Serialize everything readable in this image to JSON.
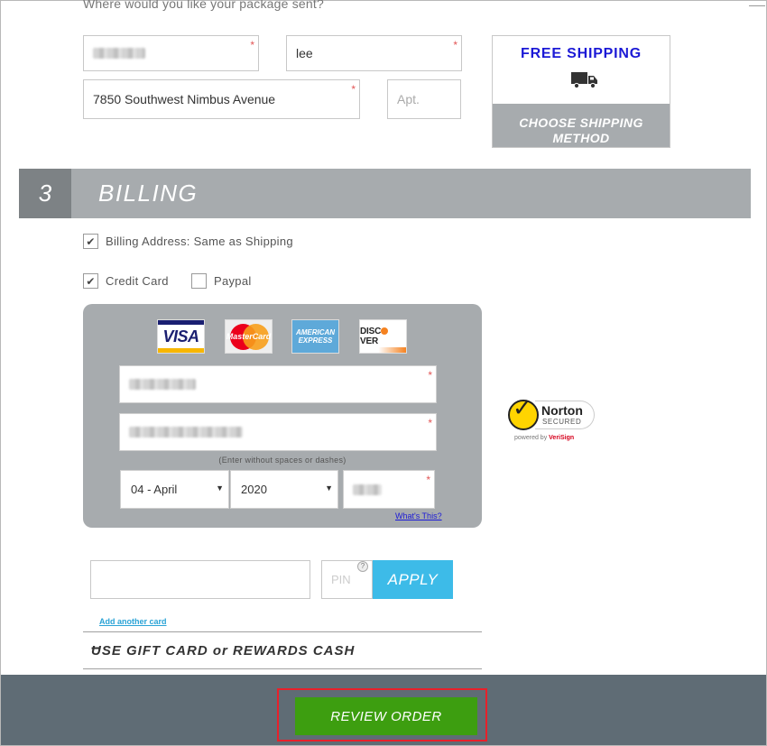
{
  "shipping": {
    "prompt": "Where would you like your package sent?",
    "last_name": "lee",
    "address": "7850 Southwest Nimbus Avenue",
    "apt_placeholder": "Apt.",
    "required_mark": "*",
    "free_shipping": "FREE SHIPPING",
    "choose_method_line1": "CHOOSE SHIPPING",
    "choose_method_line2": "METHOD",
    "truck_icon": "truck-icon"
  },
  "billing": {
    "section_number": "3",
    "section_title": "BILLING",
    "same_as_shipping_label": "Billing Address: Same as Shipping",
    "same_as_shipping_checked": true,
    "credit_card_label": "Credit Card",
    "credit_card_checked": true,
    "paypal_label": "Paypal",
    "paypal_checked": false,
    "check_mark": "✔"
  },
  "card_panel": {
    "logos": {
      "visa": "VISA",
      "mastercard": "MasterCard",
      "amex_line1": "AMERICAN",
      "amex_line2": "EXPRESS",
      "discover_a": "DISC",
      "discover_b": "VER"
    },
    "card_hint": "(Enter without spaces or dashes)",
    "expiry_month": "04 - April",
    "expiry_year": "2020",
    "dropdown_arrow": "▼",
    "whats_this": "What's This?"
  },
  "norton": {
    "check": "✓",
    "name": "Norton",
    "secured": "SECURED",
    "powered_prefix": "powered by ",
    "powered_brand": "VeriSign"
  },
  "gift_card": {
    "pin_placeholder": "PIN",
    "pin_help": "?",
    "apply_label": "APPLY",
    "add_another": "Add another card",
    "header": "USE GIFT CARD or REWARDS CASH",
    "collapse_symbol": "–"
  },
  "footer": {
    "review_order": "REVIEW ORDER"
  },
  "colors": {
    "section_bar": "#a7abae",
    "section_num_bg": "#7d8285",
    "free_shipping_text": "#1b19d6",
    "apply_bg": "#3dbbe8",
    "review_bg": "#3d9e10",
    "footer_bg": "#5f6c75",
    "highlight_outline": "#e8202a"
  }
}
